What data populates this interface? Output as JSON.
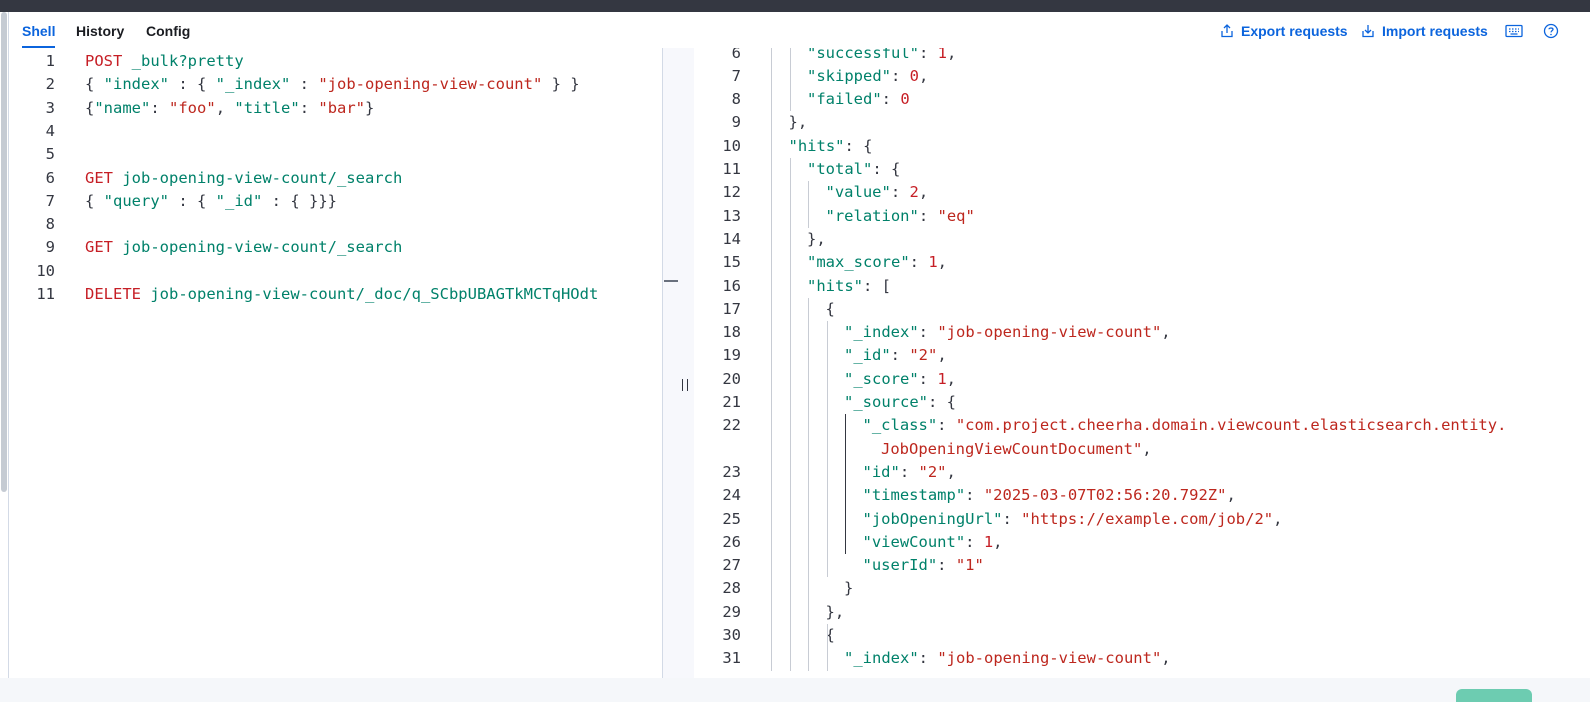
{
  "tabs": [
    {
      "label": "Shell",
      "active": true
    },
    {
      "label": "History",
      "active": false
    },
    {
      "label": "Config",
      "active": false
    }
  ],
  "actions": {
    "export_label": "Export requests",
    "import_label": "Import requests",
    "keyboard_icon": "keyboard-icon",
    "help_icon": "help-icon"
  },
  "colors": {
    "accent": "#0b64dd",
    "string": "#bd271e",
    "method": "#c61e25",
    "url": "#00816a",
    "topbar": "#343741"
  },
  "editor": {
    "lines": [
      {
        "n": "1",
        "tokens": [
          [
            "method-post",
            "POST"
          ],
          [
            "def",
            " "
          ],
          [
            "url",
            "_bulk?pretty"
          ]
        ]
      },
      {
        "n": "2",
        "tokens": [
          [
            "punc",
            "{ "
          ],
          [
            "key",
            "\"index\""
          ],
          [
            "punc",
            " : { "
          ],
          [
            "key",
            "\"_index\""
          ],
          [
            "punc",
            " : "
          ],
          [
            "str",
            "\"job-opening-view-count\""
          ],
          [
            "punc",
            " } }"
          ]
        ]
      },
      {
        "n": "3",
        "tokens": [
          [
            "punc",
            "{"
          ],
          [
            "key",
            "\"name\""
          ],
          [
            "punc",
            ": "
          ],
          [
            "str",
            "\"foo\""
          ],
          [
            "punc",
            ", "
          ],
          [
            "key",
            "\"title\""
          ],
          [
            "punc",
            ": "
          ],
          [
            "str",
            "\"bar\""
          ],
          [
            "punc",
            "}"
          ]
        ]
      },
      {
        "n": "4",
        "tokens": []
      },
      {
        "n": "5",
        "tokens": []
      },
      {
        "n": "6",
        "tokens": [
          [
            "method-get",
            "GET"
          ],
          [
            "def",
            " "
          ],
          [
            "url",
            "job-opening-view-count/_search"
          ]
        ]
      },
      {
        "n": "7",
        "tokens": [
          [
            "punc",
            "{ "
          ],
          [
            "key",
            "\"query\""
          ],
          [
            "punc",
            " : { "
          ],
          [
            "key",
            "\"_id\""
          ],
          [
            "punc",
            " : { }}}"
          ]
        ]
      },
      {
        "n": "8",
        "tokens": []
      },
      {
        "n": "9",
        "tokens": [
          [
            "method-get",
            "GET"
          ],
          [
            "def",
            " "
          ],
          [
            "url",
            "job-opening-view-count/_search"
          ]
        ]
      },
      {
        "n": "10",
        "tokens": []
      },
      {
        "n": "11",
        "tokens": [
          [
            "method-del",
            "DELETE"
          ],
          [
            "def",
            " "
          ],
          [
            "url",
            "job-opening-view-count/_doc/q_SCbpUBAGTkMCTqHOdt"
          ]
        ]
      }
    ]
  },
  "output": {
    "lines": [
      {
        "n": "6",
        "indent": 2,
        "tokens": [
          [
            "key",
            "\"successful\""
          ],
          [
            "punc",
            ": "
          ],
          [
            "num",
            "1"
          ],
          [
            "punc",
            ","
          ]
        ]
      },
      {
        "n": "7",
        "indent": 2,
        "tokens": [
          [
            "key",
            "\"skipped\""
          ],
          [
            "punc",
            ": "
          ],
          [
            "num",
            "0"
          ],
          [
            "punc",
            ","
          ]
        ]
      },
      {
        "n": "8",
        "indent": 2,
        "tokens": [
          [
            "key",
            "\"failed\""
          ],
          [
            "punc",
            ": "
          ],
          [
            "num",
            "0"
          ]
        ]
      },
      {
        "n": "9",
        "indent": 1,
        "tokens": [
          [
            "punc",
            "},"
          ]
        ]
      },
      {
        "n": "10",
        "indent": 1,
        "tokens": [
          [
            "key",
            "\"hits\""
          ],
          [
            "punc",
            ": {"
          ]
        ]
      },
      {
        "n": "11",
        "indent": 2,
        "tokens": [
          [
            "key",
            "\"total\""
          ],
          [
            "punc",
            ": {"
          ]
        ]
      },
      {
        "n": "12",
        "indent": 3,
        "tokens": [
          [
            "key",
            "\"value\""
          ],
          [
            "punc",
            ": "
          ],
          [
            "num",
            "2"
          ],
          [
            "punc",
            ","
          ]
        ]
      },
      {
        "n": "13",
        "indent": 3,
        "tokens": [
          [
            "key",
            "\"relation\""
          ],
          [
            "punc",
            ": "
          ],
          [
            "str",
            "\"eq\""
          ]
        ]
      },
      {
        "n": "14",
        "indent": 2,
        "tokens": [
          [
            "punc",
            "},"
          ]
        ]
      },
      {
        "n": "15",
        "indent": 2,
        "tokens": [
          [
            "key",
            "\"max_score\""
          ],
          [
            "punc",
            ": "
          ],
          [
            "num",
            "1"
          ],
          [
            "punc",
            ","
          ]
        ]
      },
      {
        "n": "16",
        "indent": 2,
        "tokens": [
          [
            "key",
            "\"hits\""
          ],
          [
            "punc",
            ": ["
          ]
        ]
      },
      {
        "n": "17",
        "indent": 3,
        "tokens": [
          [
            "punc",
            "{"
          ]
        ]
      },
      {
        "n": "18",
        "indent": 4,
        "tokens": [
          [
            "key",
            "\"_index\""
          ],
          [
            "punc",
            ": "
          ],
          [
            "str",
            "\"job-opening-view-count\""
          ],
          [
            "punc",
            ","
          ]
        ]
      },
      {
        "n": "19",
        "indent": 4,
        "tokens": [
          [
            "key",
            "\"_id\""
          ],
          [
            "punc",
            ": "
          ],
          [
            "str",
            "\"2\""
          ],
          [
            "punc",
            ","
          ]
        ]
      },
      {
        "n": "20",
        "indent": 4,
        "tokens": [
          [
            "key",
            "\"_score\""
          ],
          [
            "punc",
            ": "
          ],
          [
            "num",
            "1"
          ],
          [
            "punc",
            ","
          ]
        ]
      },
      {
        "n": "21",
        "indent": 4,
        "tokens": [
          [
            "key",
            "\"_source\""
          ],
          [
            "punc",
            ": {"
          ]
        ]
      },
      {
        "n": "22",
        "indent": 5,
        "tokens": [
          [
            "key",
            "\"_class\""
          ],
          [
            "punc",
            ": "
          ],
          [
            "str",
            "\"com.project.cheerha.domain.viewcount.elasticsearch.entity."
          ]
        ]
      },
      {
        "n": "",
        "indent": 6,
        "tokens": [
          [
            "str",
            "JobOpeningViewCountDocument\""
          ],
          [
            "punc",
            ","
          ]
        ]
      },
      {
        "n": "23",
        "indent": 5,
        "tokens": [
          [
            "key",
            "\"id\""
          ],
          [
            "punc",
            ": "
          ],
          [
            "str",
            "\"2\""
          ],
          [
            "punc",
            ","
          ]
        ]
      },
      {
        "n": "24",
        "indent": 5,
        "tokens": [
          [
            "key",
            "\"timestamp\""
          ],
          [
            "punc",
            ": "
          ],
          [
            "str",
            "\"2025-03-07T02:56:20.792Z\""
          ],
          [
            "punc",
            ","
          ]
        ]
      },
      {
        "n": "25",
        "indent": 5,
        "tokens": [
          [
            "key",
            "\"jobOpeningUrl\""
          ],
          [
            "punc",
            ": "
          ],
          [
            "str",
            "\"https://example.com/job/2\""
          ],
          [
            "punc",
            ","
          ]
        ]
      },
      {
        "n": "26",
        "indent": 5,
        "tokens": [
          [
            "key",
            "\"viewCount\""
          ],
          [
            "punc",
            ": "
          ],
          [
            "num",
            "1"
          ],
          [
            "punc",
            ","
          ]
        ]
      },
      {
        "n": "27",
        "indent": 5,
        "tokens": [
          [
            "key",
            "\"userId\""
          ],
          [
            "punc",
            ": "
          ],
          [
            "str",
            "\"1\""
          ]
        ]
      },
      {
        "n": "28",
        "indent": 4,
        "tokens": [
          [
            "punc",
            "}"
          ]
        ]
      },
      {
        "n": "29",
        "indent": 3,
        "tokens": [
          [
            "punc",
            "},"
          ]
        ]
      },
      {
        "n": "30",
        "indent": 3,
        "tokens": [
          [
            "punc",
            "{"
          ]
        ]
      },
      {
        "n": "31",
        "indent": 4,
        "tokens": [
          [
            "key",
            "\"_index\""
          ],
          [
            "punc",
            ": "
          ],
          [
            "str",
            "\"job-opening-view-count\""
          ],
          [
            "punc",
            ","
          ]
        ]
      }
    ]
  }
}
